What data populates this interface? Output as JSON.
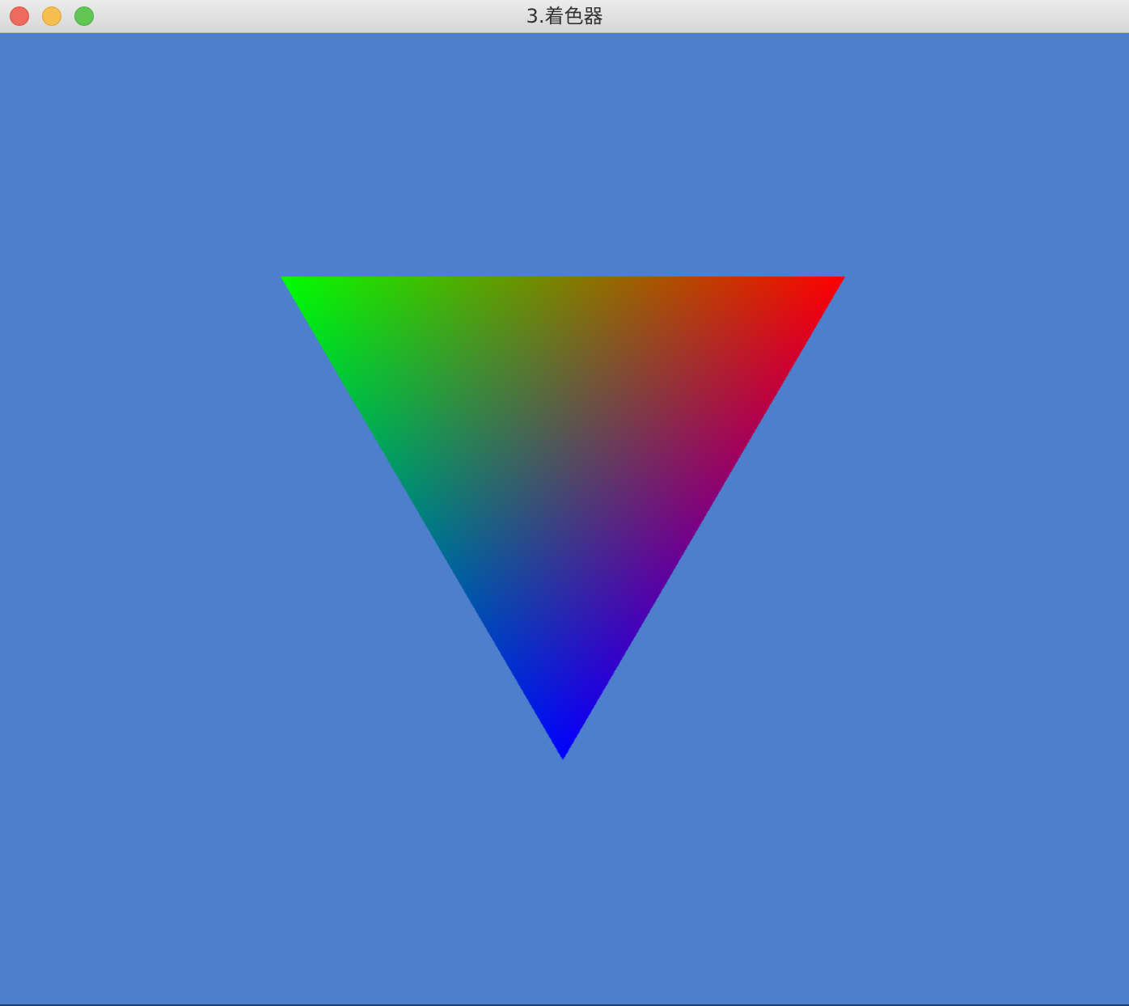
{
  "window": {
    "title": "3.着色器",
    "clear_color": "#4d7fcc"
  },
  "titlebar_buttons": [
    {
      "name": "close",
      "color": "#ee6a5f"
    },
    {
      "name": "minimize",
      "color": "#f6be4f"
    },
    {
      "name": "zoom",
      "color": "#62c655"
    }
  ],
  "triangle": {
    "vertices": [
      {
        "label": "top-left",
        "color": [
          0,
          255,
          0
        ]
      },
      {
        "label": "top-right",
        "color": [
          255,
          0,
          0
        ]
      },
      {
        "label": "bottom",
        "color": [
          0,
          0,
          255
        ]
      }
    ]
  }
}
